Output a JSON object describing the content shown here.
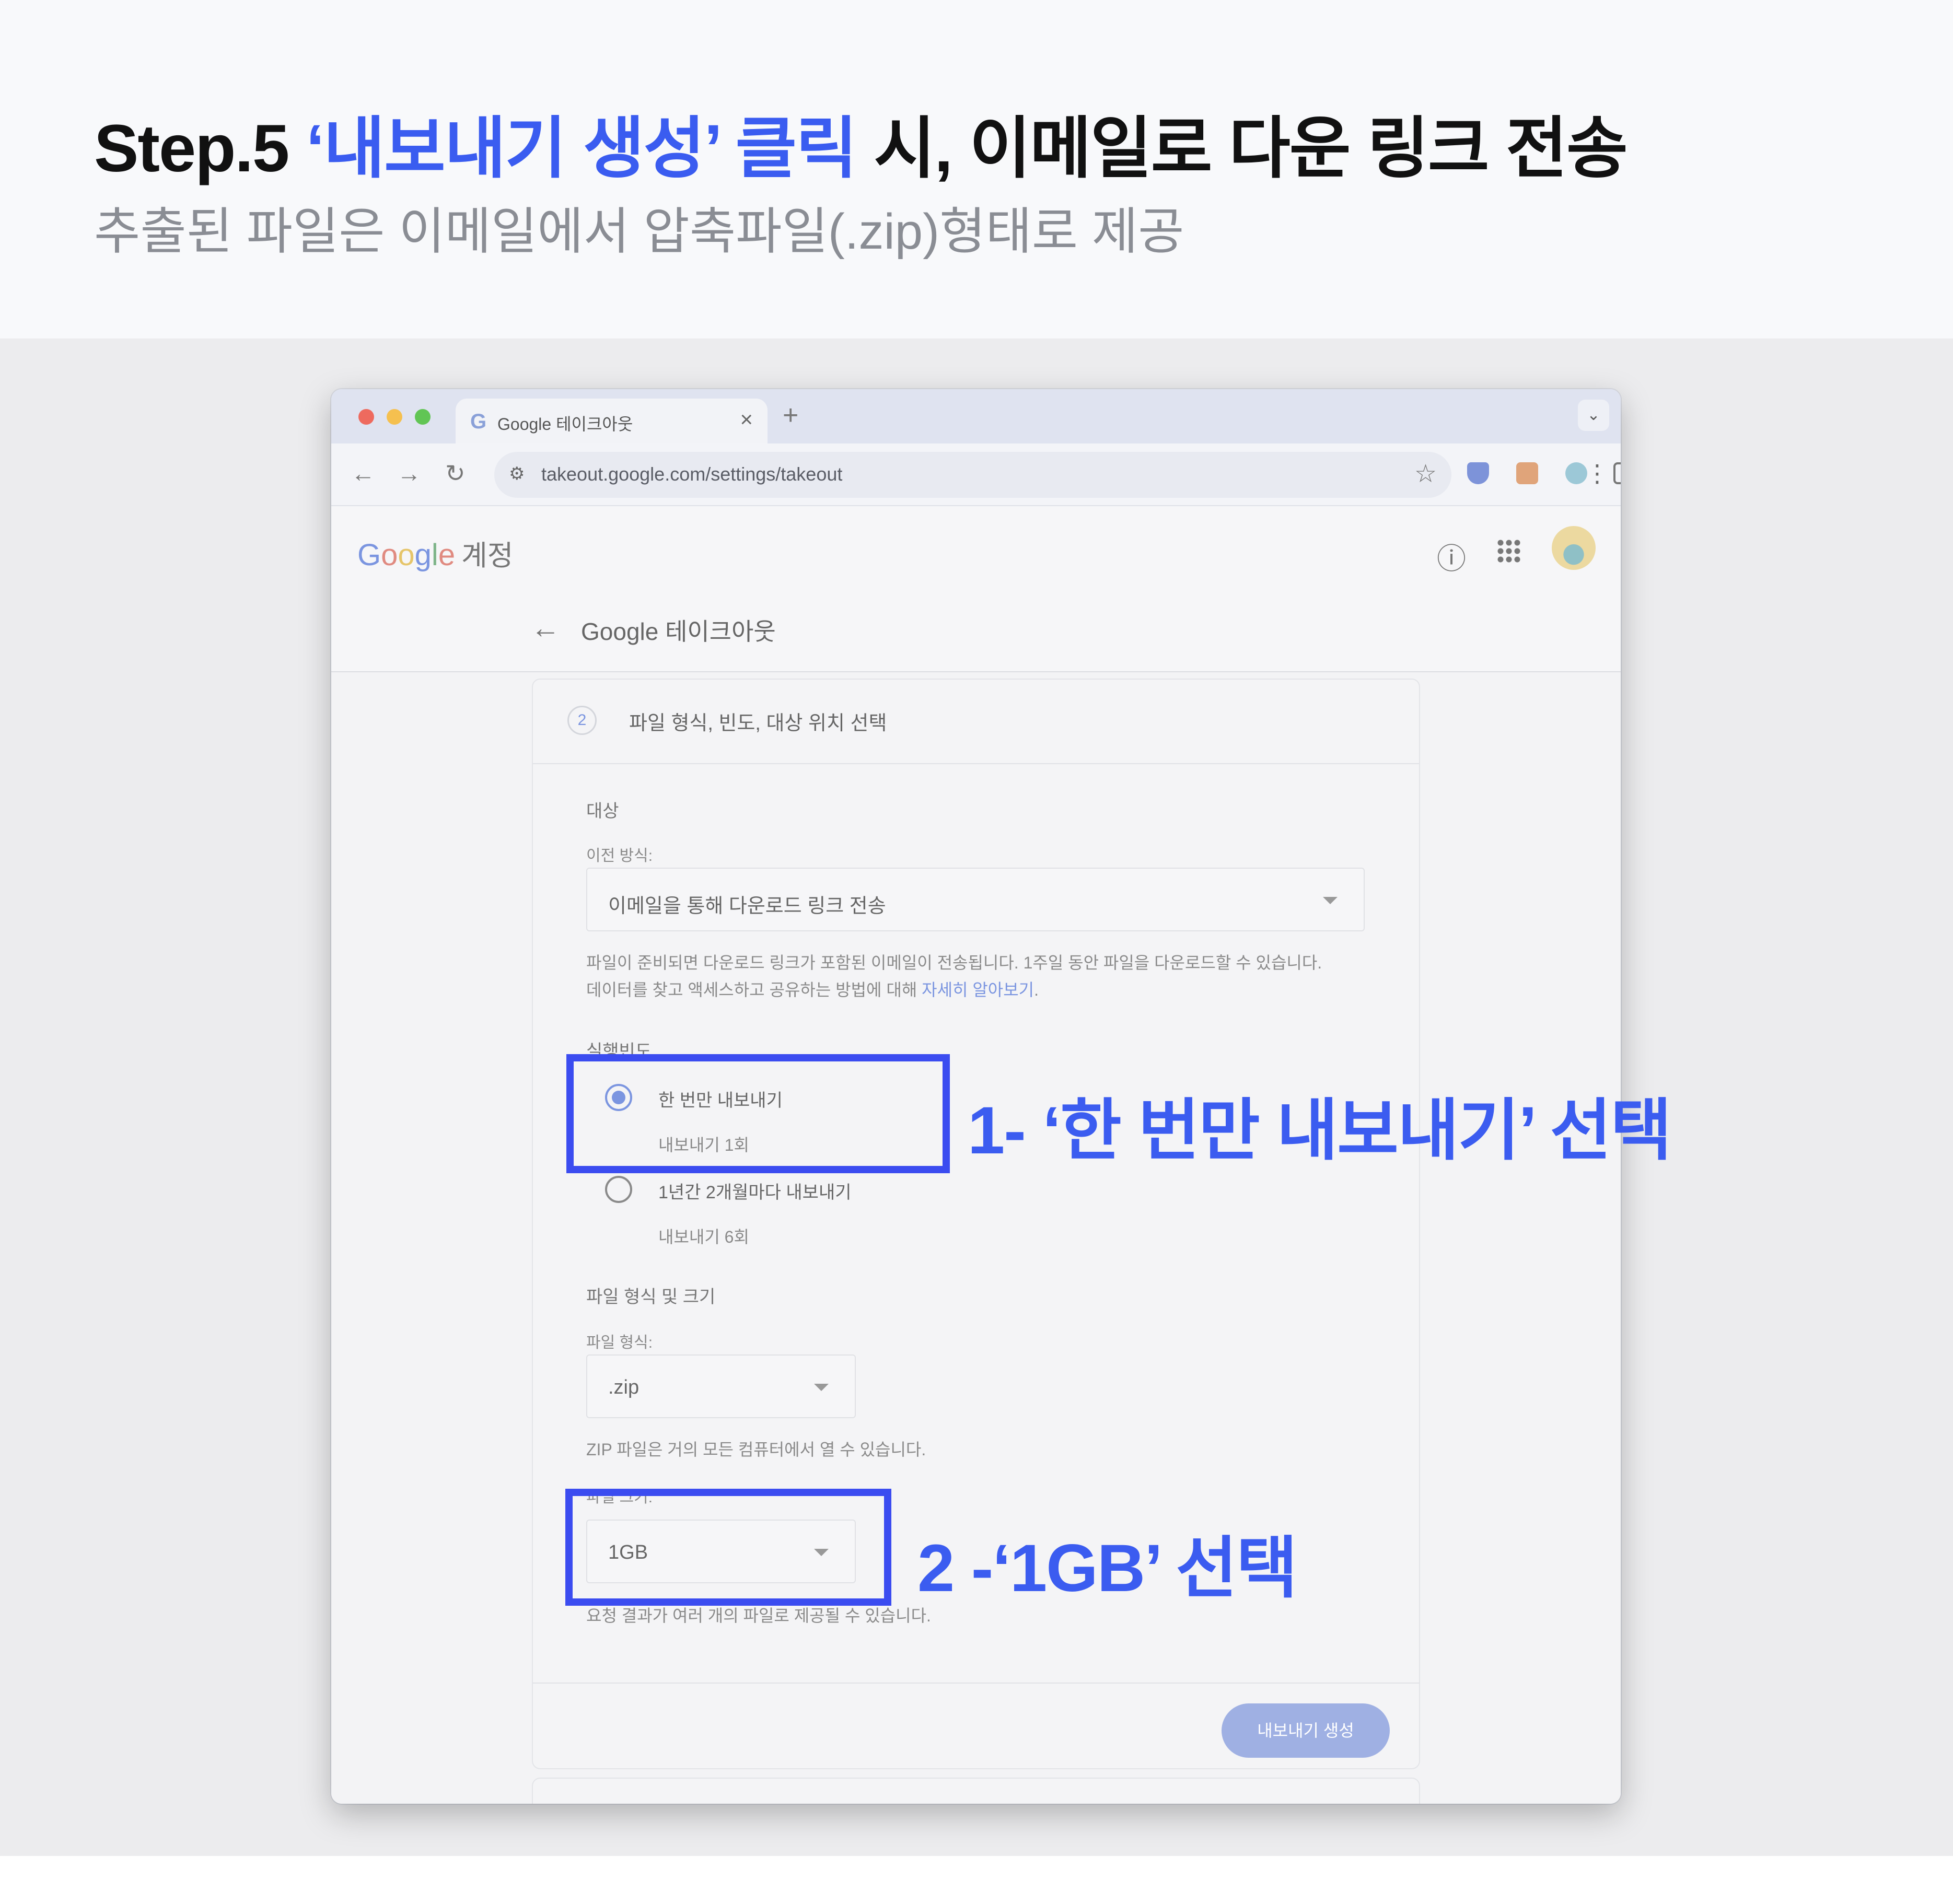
{
  "heading": {
    "step": "Step.5 ",
    "highlight": "‘내보내기 생성’ 클릭",
    "rest": " 시, 이메일로 다운 링크 전송",
    "subtitle": "추출된 파일은 이메일에서 압축파일(.zip)형태로 제공"
  },
  "browser": {
    "tab_title": "Google 테이크아웃",
    "tab_favicon": "G",
    "url": "takeout.google.com/settings/takeout"
  },
  "account_header": {
    "logo_letters": [
      "G",
      "o",
      "o",
      "g",
      "l",
      "e"
    ],
    "account_label": "계정",
    "page_title": "Google 테이크아웃"
  },
  "step": {
    "number": "2",
    "title": "파일 형식, 빈도, 대상 위치 선택"
  },
  "destination": {
    "section_label": "대상",
    "field_label": "이전 방식:",
    "value": "이메일을 통해 다운로드 링크 전송",
    "desc_line1": "파일이 준비되면 다운로드 링크가 포함된 이메일이 전송됩니다. 1주일 동안 파일을 다운로드할 수 있습니다.",
    "desc_line2": "데이터를 찾고 액세스하고 공유하는 방법에 대해 ",
    "learn_more": "자세히 알아보기",
    "desc_end": "."
  },
  "frequency": {
    "section_label": "실행빈도",
    "options": [
      {
        "label": "한 번만 내보내기",
        "sub": "내보내기 1회",
        "selected": true
      },
      {
        "label": "1년간 2개월마다 내보내기",
        "sub": "내보내기 6회",
        "selected": false
      }
    ]
  },
  "format": {
    "section_label": "파일 형식 및 크기",
    "type_label": "파일 형식:",
    "type_value": ".zip",
    "type_desc": "ZIP 파일은 거의 모든 컴퓨터에서 열 수 있습니다.",
    "size_label": "파일 크기:",
    "size_value": "1GB",
    "size_desc": "요청 결과가 여러 개의 파일로 제공될 수 있습니다."
  },
  "create_button": "내보내기 생성",
  "annotations": {
    "one": "1- ‘한 번만 내보내기’ 선택",
    "two": "2 -‘1GB’ 선택",
    "color": "#3b4cf0"
  }
}
